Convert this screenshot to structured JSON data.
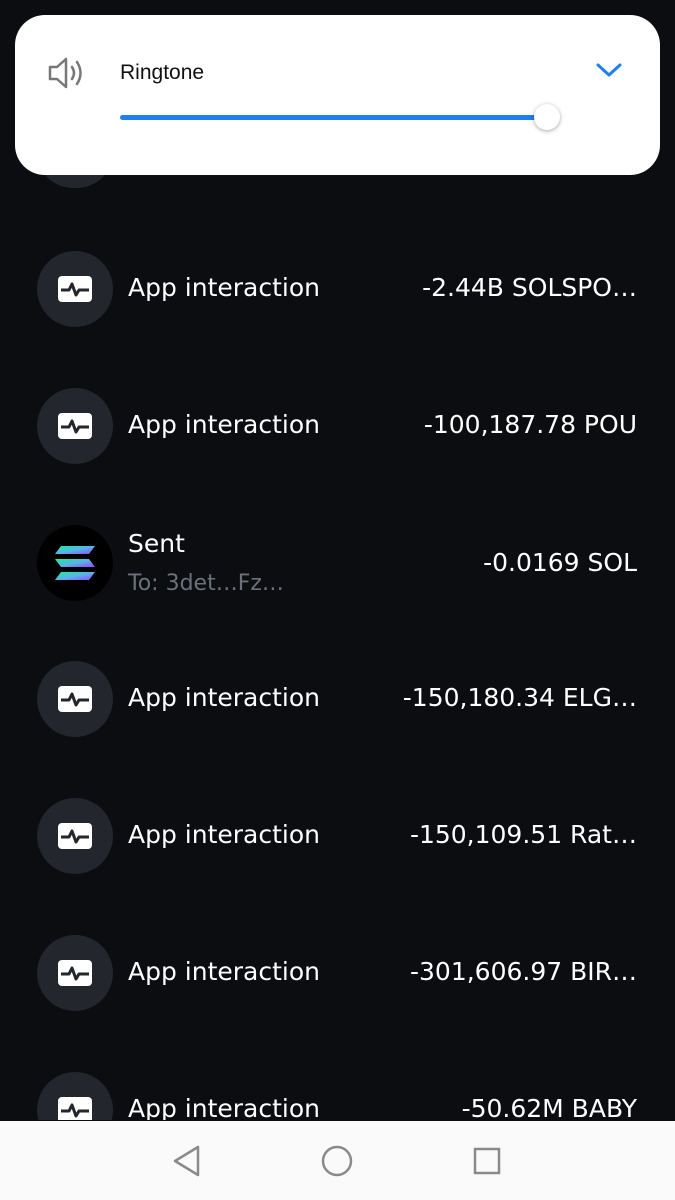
{
  "volume": {
    "label": "Ringtone",
    "level_percent": 100,
    "accent_color": "#1e7ff0",
    "speaker_icon": "speaker-icon",
    "expand_icon": "chevron-down-icon"
  },
  "transactions": [
    {
      "title": "App interaction",
      "amount": "-2.44B SOLSPO…",
      "icon": "activity-icon"
    },
    {
      "title": "App interaction",
      "amount": "-100,187.78 POU",
      "icon": "activity-icon"
    },
    {
      "title": "Sent",
      "subtitle": "To:  3det…Fz…",
      "amount": "-0.0169 SOL",
      "icon": "solana-icon"
    },
    {
      "title": "App interaction",
      "amount": "-150,180.34 ELG…",
      "icon": "activity-icon"
    },
    {
      "title": "App interaction",
      "amount": "-150,109.51 Rat…",
      "icon": "activity-icon"
    },
    {
      "title": "App interaction",
      "amount": "-301,606.97 BIR…",
      "icon": "activity-icon"
    },
    {
      "title": "App interaction",
      "amount": "-50.62M BABY",
      "icon": "activity-icon"
    }
  ],
  "navbar": {
    "back_icon": "back-triangle-icon",
    "home_icon": "home-circle-icon",
    "recents_icon": "recents-square-icon"
  }
}
